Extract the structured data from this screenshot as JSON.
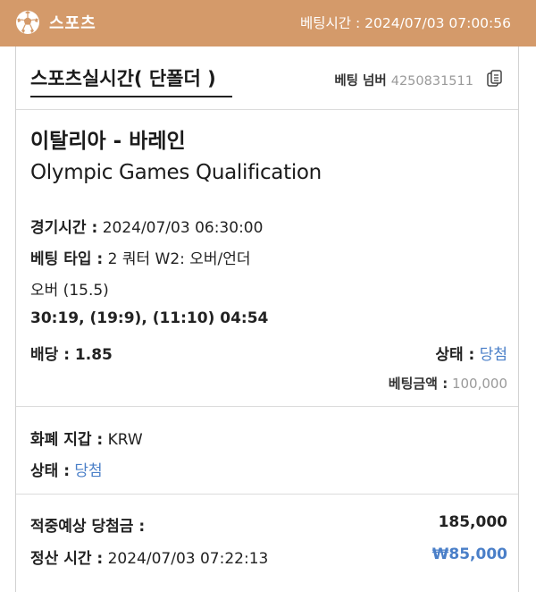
{
  "header": {
    "app_name": "스포츠",
    "bet_time_text": "베팅시간 : 2024/07/03 07:00:56",
    "icon": "soccer-ball-icon"
  },
  "card": {
    "section_title": "스포츠실시간( 단폴더 )",
    "bet_number_label": "베팅 넘버",
    "bet_number": "4250831511",
    "copy_icon": "copy-document-icon",
    "match": "이탈리아 - 바레인",
    "league": "Olympic Games Qualification",
    "game_time_label": "경기시간 :",
    "game_time": "2024/07/03 06:30:00",
    "bet_type_label": "베팅 타입 :",
    "bet_type": "2 쿼터 W2: 오버/언더",
    "pick": "오버 (15.5)",
    "score": "30:19, (19:9), (11:10) 04:54",
    "odds_text": "배당 : 1.85",
    "status_label": "상태 :",
    "status_value": "당첨",
    "bet_amount_label": "베팅금액 :",
    "bet_amount": "100,000",
    "currency_label": "화폐 지갑 :",
    "currency": "KRW",
    "status2_label": "상태 :",
    "status2_value": "당첨",
    "expected_win_label": "적중예상 당첨금 :",
    "expected_win": "185,000",
    "settle_time_label": "정산 시간 :",
    "settle_time": "2024/07/03 07:22:13",
    "profit": "₩85,000"
  },
  "colors": {
    "header_bg": "#d49a6a",
    "accent_blue": "#4a7fc8",
    "muted_gray": "#9a9a9a"
  }
}
